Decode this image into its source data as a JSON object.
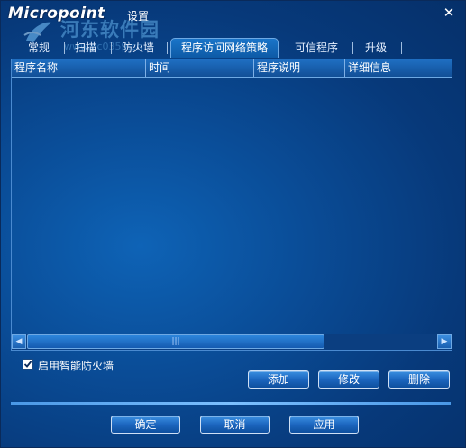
{
  "titlebar": {
    "logo": "Micropoint",
    "title": "设置",
    "close_glyph": "✕"
  },
  "watermark": {
    "text": "河东软件园",
    "url": "www.pc0359.cn"
  },
  "tabs": [
    {
      "label": "常规"
    },
    {
      "label": "扫描"
    },
    {
      "label": "防火墙"
    },
    {
      "label": "程序访问网络策略",
      "active": true
    },
    {
      "label": "可信程序"
    },
    {
      "label": "升级"
    }
  ],
  "list": {
    "columns": [
      "程序名称",
      "时间",
      "程序说明",
      "详细信息"
    ],
    "rows": []
  },
  "scrollbar": {
    "left_glyph": "◀",
    "right_glyph": "▶",
    "thumb_grip": "|||"
  },
  "options": {
    "enable_firewall_label": "启用智能防火墙",
    "enable_firewall_checked": true
  },
  "actions": {
    "add_label": "添加",
    "modify_label": "修改",
    "delete_label": "删除"
  },
  "footer": {
    "ok_label": "确定",
    "cancel_label": "取消",
    "apply_label": "应用"
  },
  "colors": {
    "background": "#0a4d98",
    "accent": "#4a98e6",
    "header": "#1f6fc2"
  }
}
